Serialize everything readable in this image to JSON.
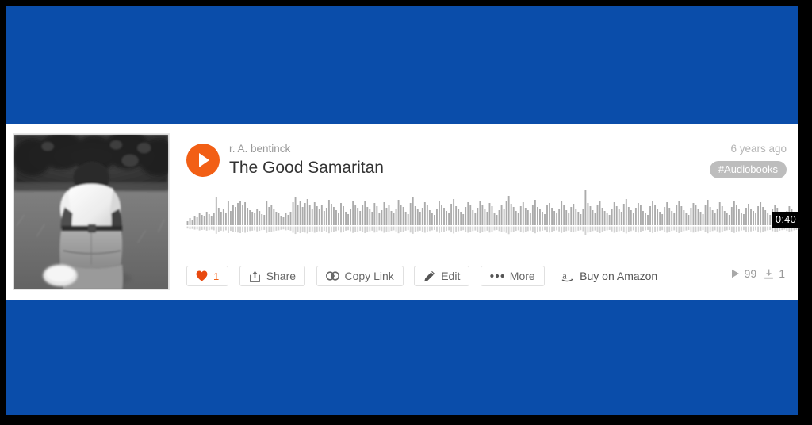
{
  "theme": {
    "backdrop_blue": "#0a4daa",
    "frame_black": "#000000",
    "card_white": "#ffffff",
    "accent_orange": "#f25f15",
    "waveform_gray": "#999999",
    "tag_gray": "#bdbdbd"
  },
  "artwork": {
    "alt": "black and white photo of a person seen from behind standing on grass in front of a hedge"
  },
  "track": {
    "artist": "r. A. bentinck",
    "title": "The Good Samaritan",
    "uploaded": "6 years ago",
    "tag": "#Audiobooks",
    "duration": "0:40",
    "play_icon": "play-triangle-icon"
  },
  "actions": {
    "like": {
      "label": "",
      "count": "1",
      "icon": "heart-icon"
    },
    "share": {
      "label": "Share",
      "icon": "share-icon"
    },
    "copy_link": {
      "label": "Copy Link",
      "icon": "link-icon"
    },
    "edit": {
      "label": "Edit",
      "icon": "pencil-icon"
    },
    "more": {
      "label": "More",
      "icon": "ellipsis-icon"
    },
    "buy": {
      "label": "Buy on Amazon",
      "icon": "amazon-a-icon"
    }
  },
  "stats": {
    "plays": {
      "value": "99",
      "icon": "play-small-icon"
    },
    "downloads": {
      "value": "1",
      "icon": "download-icon"
    }
  },
  "chart_data": {
    "type": "bar",
    "title": "Audio waveform preview",
    "xlabel": "",
    "ylabel": "amplitude",
    "ylim": [
      0,
      1
    ],
    "note": "Peak amplitudes sampled left-to-right across the 0:40 track; bars render upward from a baseline with small mirrored stubs below.",
    "values": [
      0.1,
      0.18,
      0.14,
      0.22,
      0.2,
      0.32,
      0.26,
      0.24,
      0.34,
      0.28,
      0.22,
      0.3,
      0.7,
      0.44,
      0.34,
      0.4,
      0.3,
      0.62,
      0.36,
      0.5,
      0.46,
      0.56,
      0.62,
      0.52,
      0.58,
      0.44,
      0.38,
      0.34,
      0.3,
      0.42,
      0.36,
      0.28,
      0.26,
      0.6,
      0.46,
      0.5,
      0.4,
      0.34,
      0.3,
      0.24,
      0.2,
      0.3,
      0.26,
      0.34,
      0.58,
      0.72,
      0.52,
      0.62,
      0.46,
      0.56,
      0.66,
      0.5,
      0.42,
      0.58,
      0.48,
      0.4,
      0.52,
      0.36,
      0.44,
      0.64,
      0.54,
      0.46,
      0.38,
      0.3,
      0.56,
      0.48,
      0.34,
      0.28,
      0.4,
      0.6,
      0.5,
      0.44,
      0.36,
      0.52,
      0.62,
      0.46,
      0.4,
      0.34,
      0.56,
      0.48,
      0.3,
      0.38,
      0.58,
      0.44,
      0.5,
      0.36,
      0.3,
      0.42,
      0.64,
      0.52,
      0.46,
      0.34,
      0.28,
      0.56,
      0.7,
      0.48,
      0.4,
      0.34,
      0.44,
      0.58,
      0.5,
      0.38,
      0.3,
      0.26,
      0.42,
      0.6,
      0.52,
      0.44,
      0.36,
      0.3,
      0.54,
      0.66,
      0.48,
      0.4,
      0.34,
      0.28,
      0.46,
      0.58,
      0.5,
      0.38,
      0.32,
      0.44,
      0.62,
      0.52,
      0.4,
      0.34,
      0.56,
      0.48,
      0.3,
      0.26,
      0.38,
      0.5,
      0.42,
      0.6,
      0.74,
      0.54,
      0.46,
      0.36,
      0.3,
      0.48,
      0.58,
      0.44,
      0.38,
      0.32,
      0.52,
      0.64,
      0.46,
      0.4,
      0.34,
      0.28,
      0.5,
      0.56,
      0.44,
      0.36,
      0.3,
      0.42,
      0.6,
      0.5,
      0.38,
      0.32,
      0.46,
      0.54,
      0.42,
      0.34,
      0.28,
      0.4,
      0.88,
      0.56,
      0.48,
      0.38,
      0.32,
      0.5,
      0.62,
      0.44,
      0.36,
      0.3,
      0.26,
      0.42,
      0.58,
      0.48,
      0.4,
      0.34,
      0.54,
      0.66,
      0.46,
      0.38,
      0.3,
      0.44,
      0.56,
      0.5,
      0.36,
      0.3,
      0.26,
      0.48,
      0.6,
      0.52,
      0.4,
      0.34,
      0.28,
      0.46,
      0.58,
      0.44,
      0.36,
      0.3,
      0.5,
      0.62,
      0.48,
      0.38,
      0.32,
      0.26,
      0.44,
      0.56,
      0.5,
      0.4,
      0.34,
      0.28,
      0.52,
      0.64,
      0.46,
      0.38,
      0.3,
      0.42,
      0.58,
      0.48,
      0.36,
      0.3,
      0.26,
      0.46,
      0.6,
      0.5,
      0.4,
      0.32,
      0.28,
      0.44,
      0.54,
      0.42,
      0.36,
      0.3,
      0.48,
      0.58,
      0.46,
      0.38,
      0.3,
      0.26,
      0.4,
      0.52,
      0.44,
      0.34,
      0.28,
      0.22,
      0.36,
      0.48,
      0.4,
      0.3,
      0.26,
      0.2
    ]
  }
}
